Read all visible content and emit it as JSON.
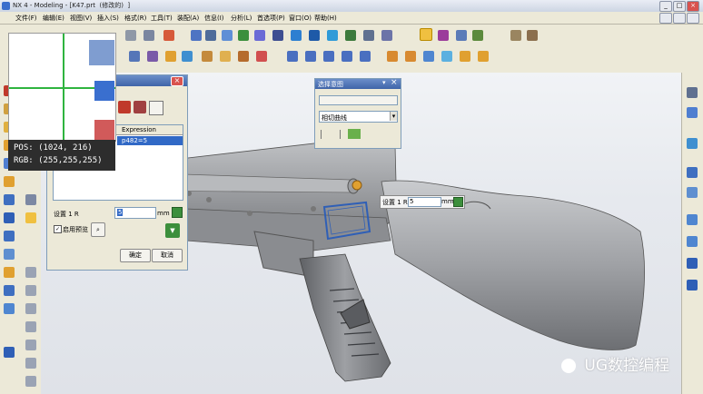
{
  "window": {
    "title": "NX 4 - Modeling - [K47.prt  (修改的)  ]",
    "min": "_",
    "max": "□",
    "close": "×"
  },
  "menu": {
    "items": [
      "文件(F)",
      "编辑(E)",
      "视图(V)",
      "插入(S)",
      "格式(R)",
      "工具(T)",
      "装配(A)",
      "信息(I)",
      "分析(L)",
      "首选项(P)",
      "窗口(O)",
      "帮助(H)"
    ]
  },
  "dialog": {
    "column_header": "Expression",
    "selected_expression": "p482=5",
    "offset_label": "设置 1 R",
    "offset_value": "5",
    "unit": "mm",
    "preview_label": "启用预览",
    "ok": "确定",
    "cancel": "取消"
  },
  "selection_bar": {
    "title": "选择意图",
    "close": "×",
    "dropdown_empty": "",
    "intent_value": "相切曲线"
  },
  "inline_editor": {
    "label": "设置 1 R",
    "value": "5",
    "unit": "mm"
  },
  "magnifier": {
    "pos_label": "POS: (1024, 216)",
    "rgb_label": "RGB: (255,255,255)"
  },
  "watermark": {
    "text": "UG数控编程"
  },
  "colors": {
    "accent_blue": "#2f5fb6",
    "model_gray": "#8d8f93",
    "viewport_bg": "#eef0f3",
    "crosshair_green": "#2fb43f"
  }
}
